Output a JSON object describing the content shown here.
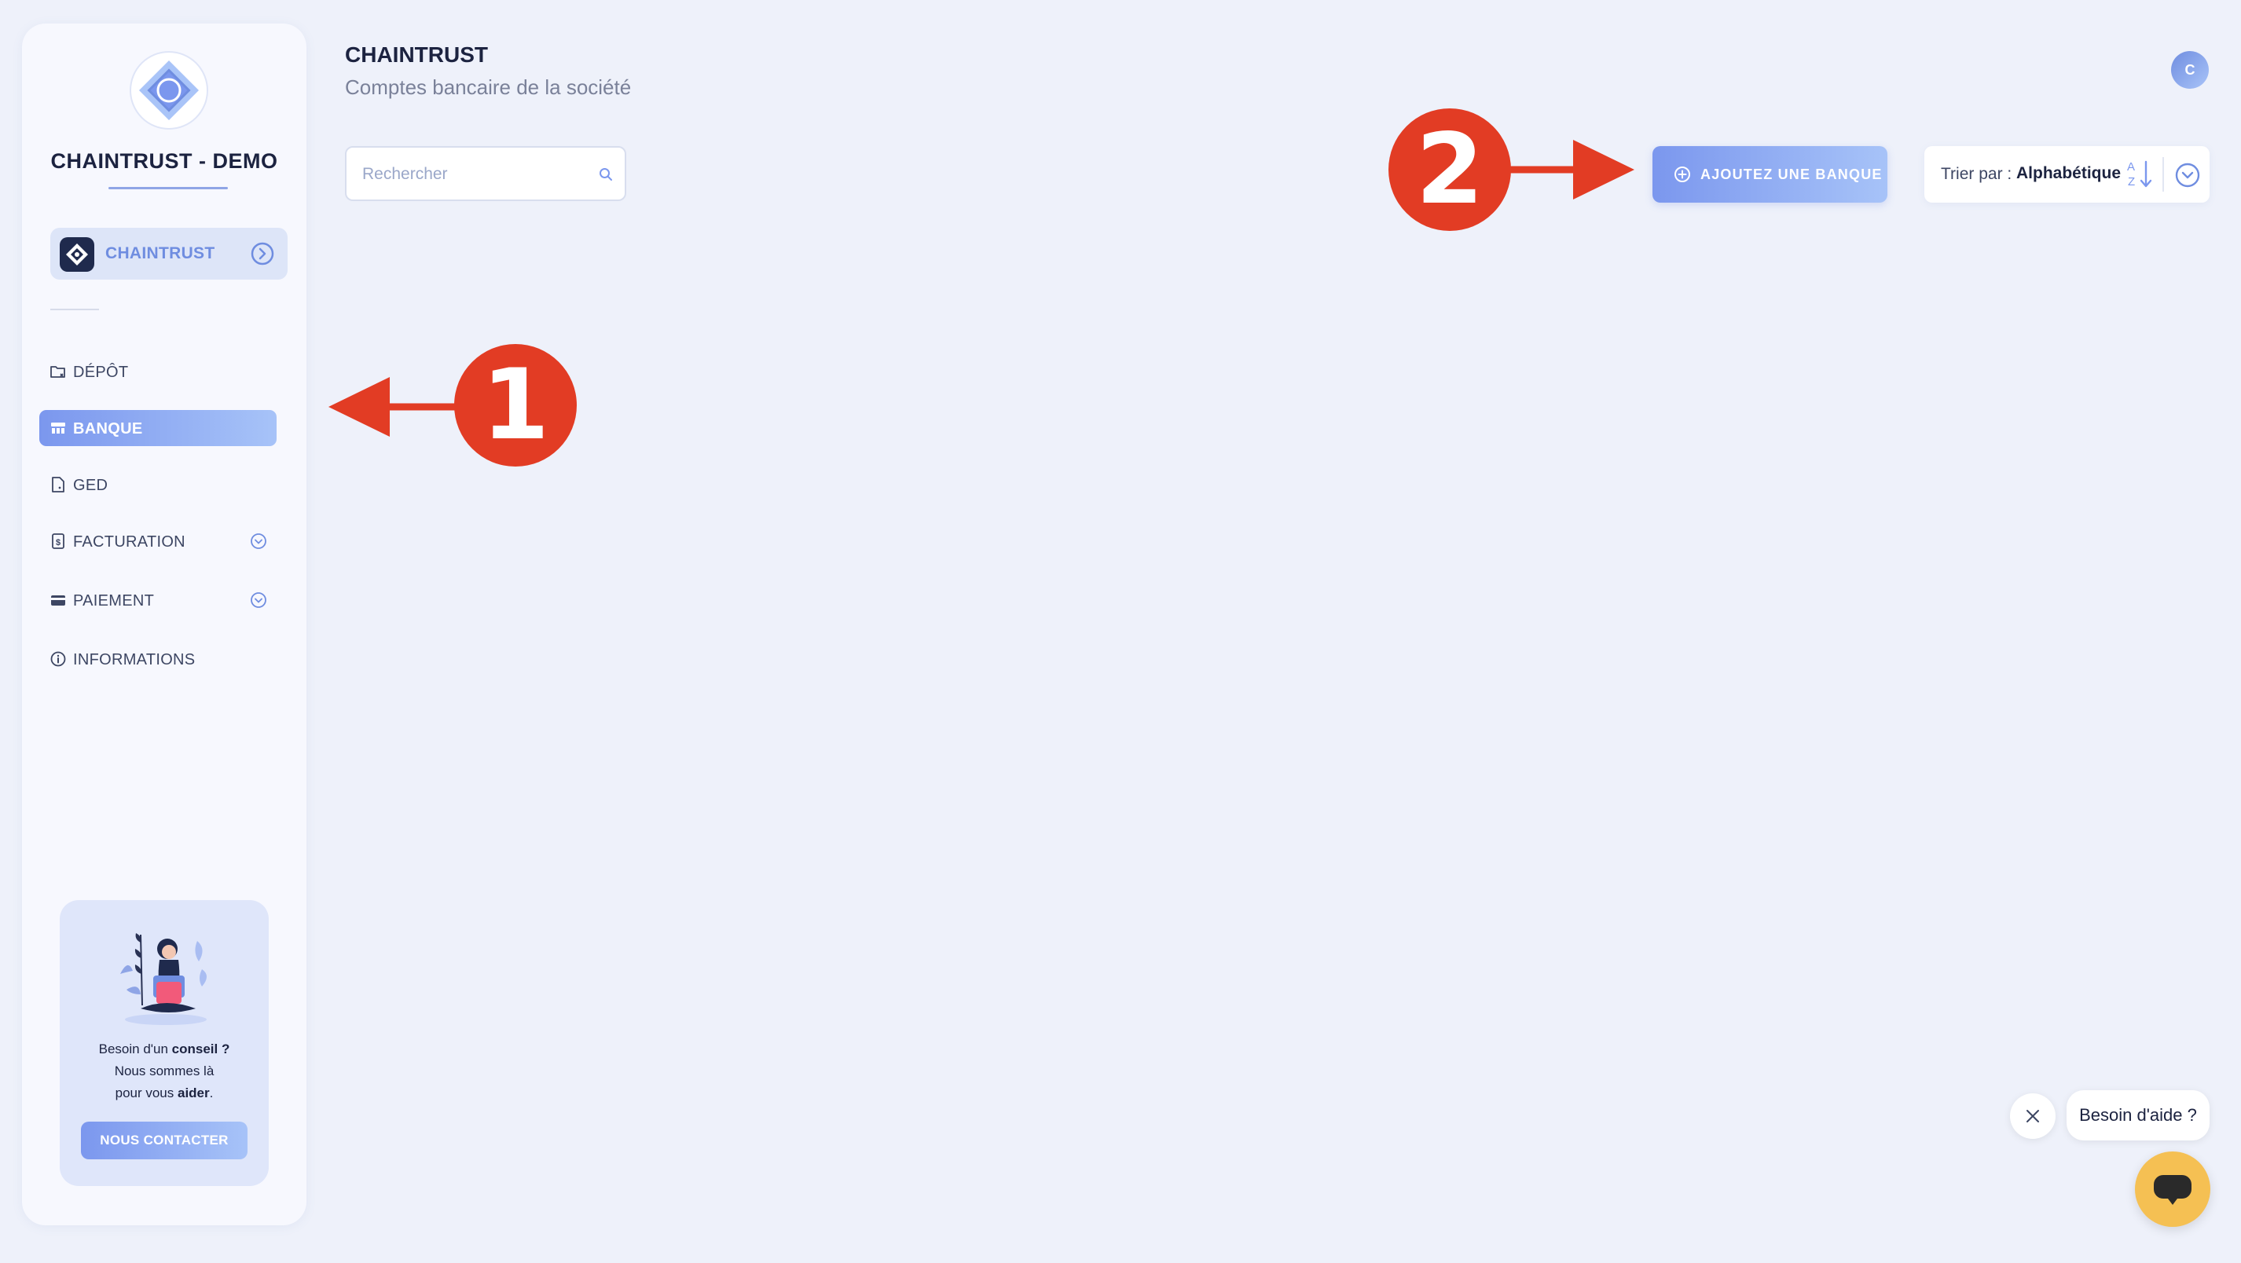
{
  "sidebar": {
    "company_name": "CHAINTRUST - DEMO",
    "org_switch": {
      "label": "CHAINTRUST",
      "avatar_letter": "C"
    },
    "nav": [
      {
        "label": "DÉPÔT",
        "icon": "folder-icon",
        "active": false
      },
      {
        "label": "BANQUE",
        "icon": "bank-icon",
        "active": true
      },
      {
        "label": "GED",
        "icon": "document-icon",
        "active": false
      },
      {
        "label": "FACTURATION",
        "icon": "invoice-icon",
        "active": false,
        "expandable": true
      },
      {
        "label": "PAIEMENT",
        "icon": "credit-card-icon",
        "active": false,
        "expandable": true
      },
      {
        "label": "INFORMATIONS",
        "icon": "info-icon",
        "active": false
      }
    ],
    "help_card": {
      "line1_prefix": "Besoin d'un ",
      "line1_bold": "conseil",
      "line1_suffix": " ?",
      "line2": "Nous sommes là",
      "line3_prefix": "pour vous ",
      "line3_bold": "aider",
      "line3_suffix": ".",
      "button_label": "NOUS CONTACTER"
    }
  },
  "header": {
    "title": "CHAINTRUST",
    "subtitle": "Comptes bancaire de la société",
    "user_initial": "C"
  },
  "toolbar": {
    "search_placeholder": "Rechercher",
    "add_bank_label": "AJOUTEZ UNE BANQUE",
    "sort_prefix": "Trier par :",
    "sort_value": "Alphabétique",
    "sort_icon_top": "A",
    "sort_icon_bottom": "Z"
  },
  "chat": {
    "bubble_text": "Besoin d'aide ?"
  },
  "annotations": {
    "marker_1": "1",
    "marker_2": "2"
  },
  "colors": {
    "accent": "#7b97ee",
    "accent_light": "#a7c3f8",
    "annotation_red": "#e23c24",
    "chat_yellow": "#f5c053",
    "background": "#eef1fa"
  }
}
